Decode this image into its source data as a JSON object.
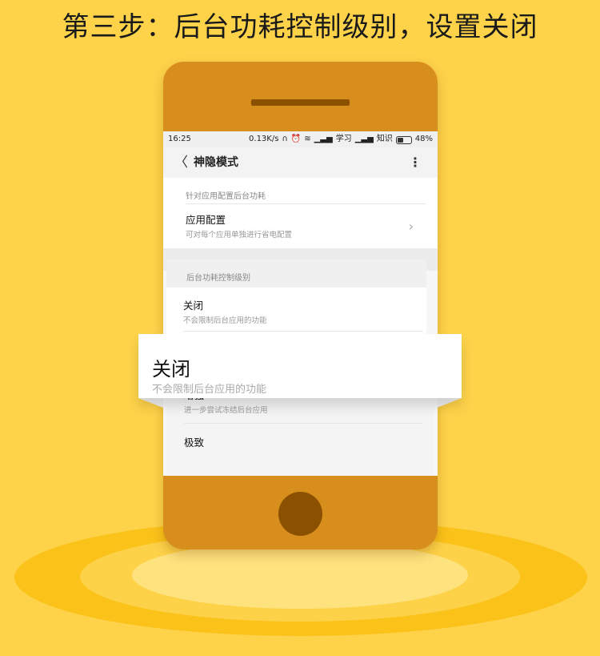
{
  "heading": "第三步：后台功耗控制级别，设置关闭",
  "status_bar": {
    "time": "16:25",
    "speed": "0.13K/s",
    "carrier1": "学习",
    "carrier2": "知识",
    "battery": "48%"
  },
  "app_bar": {
    "title": "神隐模式"
  },
  "section1": {
    "label": "针对应用配置后台功耗",
    "app_config": {
      "title": "应用配置",
      "subtitle": "可对每个应用单独进行省电配置"
    }
  },
  "section2": {
    "label": "后台功耗控制级别",
    "options": [
      {
        "title": "关闭",
        "subtitle": "不会限制后台应用的功能"
      },
      {
        "title": "增强",
        "subtitle": "进一步尝试冻结后台应用"
      },
      {
        "title": "极致",
        "subtitle": ""
      }
    ]
  },
  "popup": {
    "title": "关闭",
    "subtitle": "不会限制后台应用的功能"
  }
}
